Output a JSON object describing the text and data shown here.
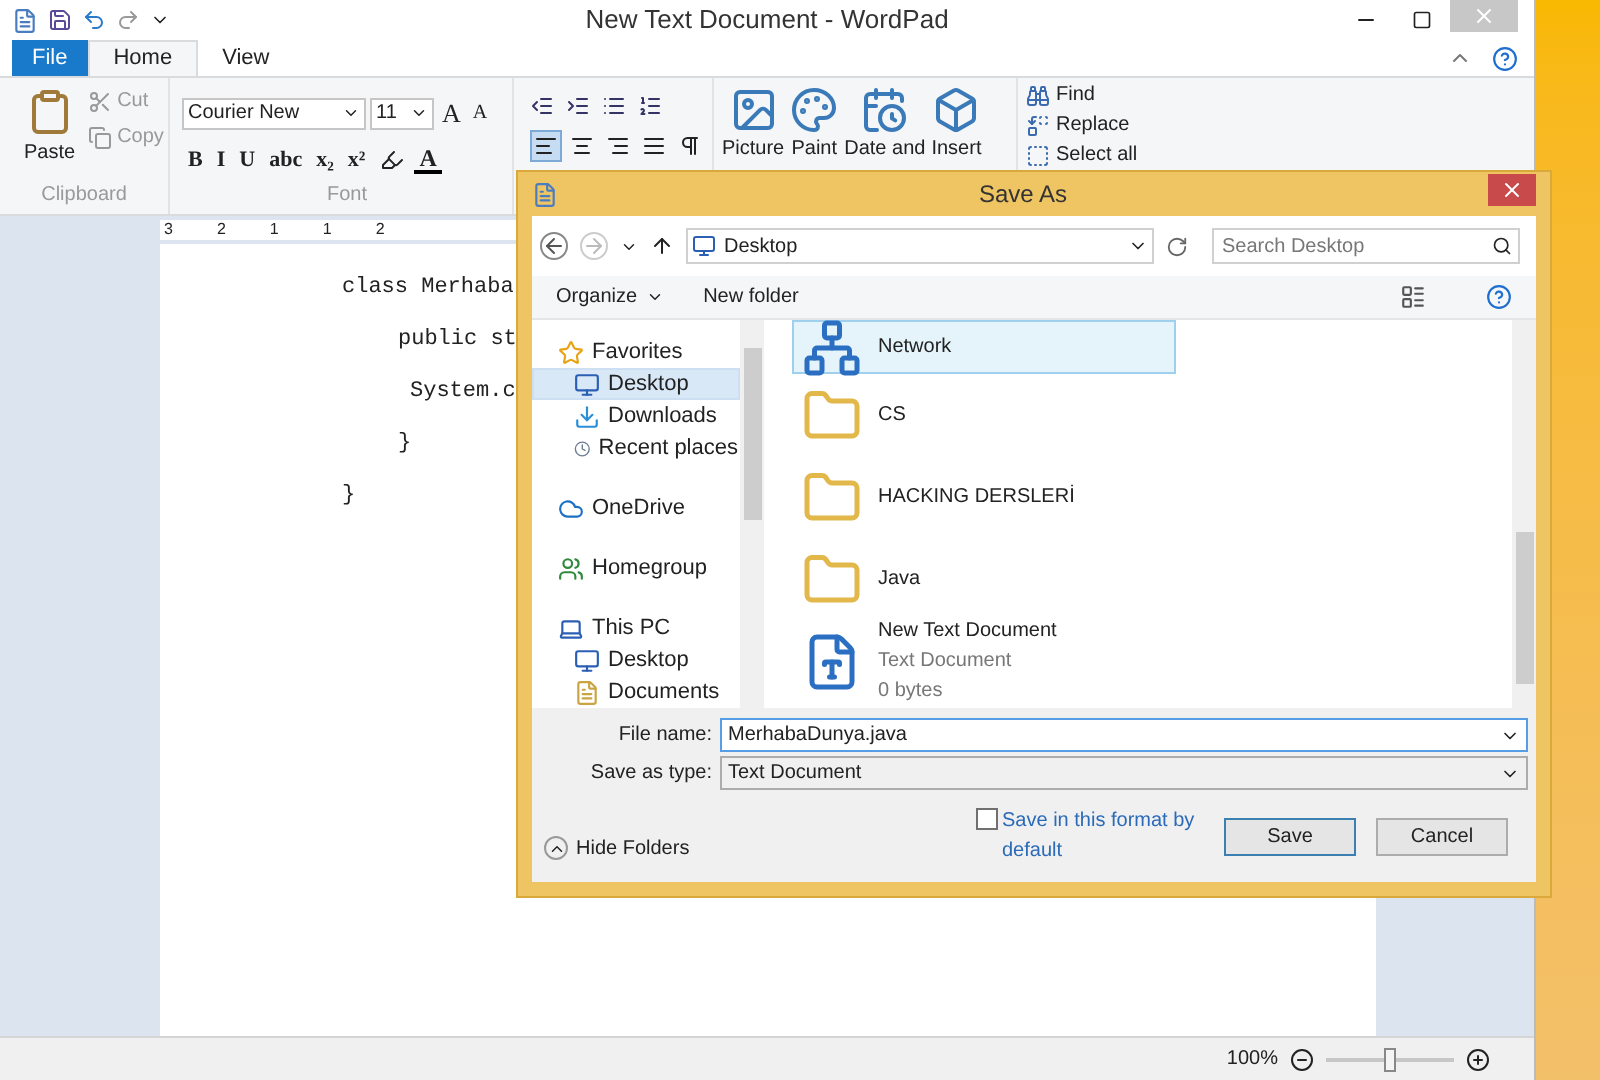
{
  "window": {
    "title": "New Text Document - WordPad"
  },
  "tabs": [
    {
      "label": "File",
      "kind": "file",
      "selected": false
    },
    {
      "label": "Home",
      "kind": "tab",
      "selected": true
    },
    {
      "label": "View",
      "kind": "tab",
      "selected": false
    }
  ],
  "ribbon": {
    "clipboard": {
      "label": "Clipboard",
      "paste": "Paste",
      "cut": "Cut",
      "copy": "Copy"
    },
    "font": {
      "label": "Font",
      "family": "Courier New",
      "size": "11",
      "grow": "A",
      "shrink": "A",
      "format_buttons": [
        "B",
        "I",
        "U",
        "abc",
        "x₂",
        "x²"
      ],
      "color_button": "A"
    },
    "align_buttons": [
      {
        "selected": true
      },
      {
        "selected": false
      },
      {
        "selected": false
      },
      {
        "selected": false
      }
    ],
    "insert": [
      "Picture",
      "Paint",
      "Date and",
      "Insert"
    ],
    "editing": [
      "Find",
      "Replace",
      "Select all"
    ]
  },
  "ruler": [
    "3",
    "2",
    "1",
    "1",
    "2"
  ],
  "document": {
    "lines": [
      {
        "text": "class Merhaba",
        "children": [
          {
            "text": "public st",
            "children": [
              {
                "text": "System.c"
              }
            ]
          },
          {
            "text": "}"
          }
        ]
      },
      {
        "text": "}"
      }
    ]
  },
  "status_bar": {
    "zoom": "100%",
    "level": 0.5
  },
  "dialog": {
    "title": "Save As",
    "address": "Desktop",
    "search": {
      "placeholder": "Search Desktop"
    },
    "toolbar": [
      "Organize",
      "New folder"
    ],
    "nav": [
      {
        "label": "Favorites",
        "kind": "star",
        "selected": false,
        "children": [
          {
            "label": "Desktop",
            "kind": "desktop",
            "selected": true
          },
          {
            "label": "Downloads",
            "kind": "downloads",
            "selected": false
          },
          {
            "label": "Recent places",
            "kind": "recent",
            "selected": false
          }
        ]
      },
      {
        "label": "OneDrive",
        "kind": "cloud",
        "selected": false
      },
      {
        "label": "Homegroup",
        "kind": "homegroup",
        "selected": false
      },
      {
        "label": "This PC",
        "kind": "pc",
        "selected": false,
        "children": [
          {
            "label": "Desktop",
            "kind": "desktop",
            "selected": false
          },
          {
            "label": "Documents",
            "kind": "documents",
            "selected": false
          }
        ]
      }
    ],
    "files": [
      {
        "name": "Network",
        "kind": "network",
        "selected": true
      },
      {
        "name": "CS",
        "kind": "folder",
        "selected": false
      },
      {
        "name": "HACKING DERSLERİ",
        "kind": "folder",
        "selected": false
      },
      {
        "name": "Java",
        "kind": "folder",
        "selected": false
      },
      {
        "name": "New Text Document",
        "kind": "document",
        "selected": false,
        "details": [
          "Text Document",
          "0 bytes"
        ]
      }
    ],
    "file_name": {
      "label": "File name:",
      "value": "MerhabaDunya.java"
    },
    "save_type": {
      "label": "Save as type:",
      "value": "Text Document"
    },
    "default_format": {
      "label": "Save in this format by default",
      "checked": false
    },
    "buttons": [
      "Save",
      "Cancel"
    ],
    "hide_folders": "Hide Folders"
  }
}
